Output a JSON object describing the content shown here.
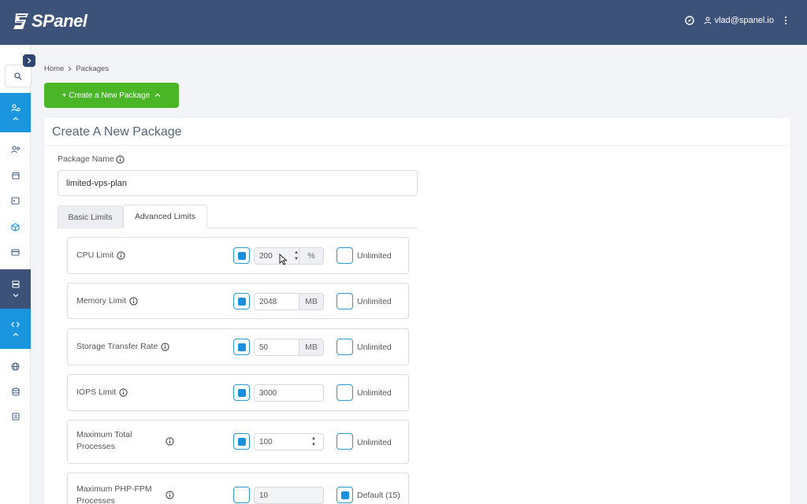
{
  "header": {
    "logo_text": "SPanel",
    "user": "vlad@spanel.io",
    "compass_icon": "compass-icon",
    "user_icon": "user-icon",
    "menu_icon": "kebab-menu-icon"
  },
  "sidebar": {
    "icons": [
      "search-icon",
      "users-settings-icon",
      "users-icon",
      "calendar-icon",
      "terminal-icon",
      "cube-icon",
      "card-icon",
      "server-icon",
      "code-icon",
      "globe-icon",
      "database-icon",
      "document-icon"
    ]
  },
  "breadcrumb": {
    "home": "Home",
    "current": "Packages"
  },
  "create_button": {
    "label": "+ Create a New Package"
  },
  "card": {
    "title": "Create A New Package"
  },
  "form": {
    "package_name_label": "Package Name",
    "package_name_value": "limited-vps-plan",
    "tabs": {
      "basic": "Basic Limits",
      "advanced": "Advanced Limits"
    }
  },
  "limits": {
    "cpu": {
      "label": "CPU Limit",
      "value": "200",
      "unit": "%",
      "unlimited": "Unlimited"
    },
    "memory": {
      "label": "Memory Limit",
      "value": "2048",
      "unit": "MB",
      "unlimited": "Unlimited"
    },
    "storage": {
      "label": "Storage Transfer Rate",
      "value": "50",
      "unit": "MB",
      "unlimited": "Unlimited"
    },
    "iops": {
      "label": "IOPS Limit",
      "value": "3000",
      "unlimited": "Unlimited"
    },
    "processes": {
      "label_line1": "Maximum Total",
      "label_line2": "Processes",
      "value": "100",
      "unlimited": "Unlimited"
    },
    "phpfpm": {
      "label_line1": "Maximum PHP-FPM",
      "label_line2": "Processes",
      "value": "10",
      "default": "Default (15)"
    }
  },
  "colors": {
    "topbar": "#3d5279",
    "accent": "#1b95dd",
    "create_button": "#49b527"
  }
}
